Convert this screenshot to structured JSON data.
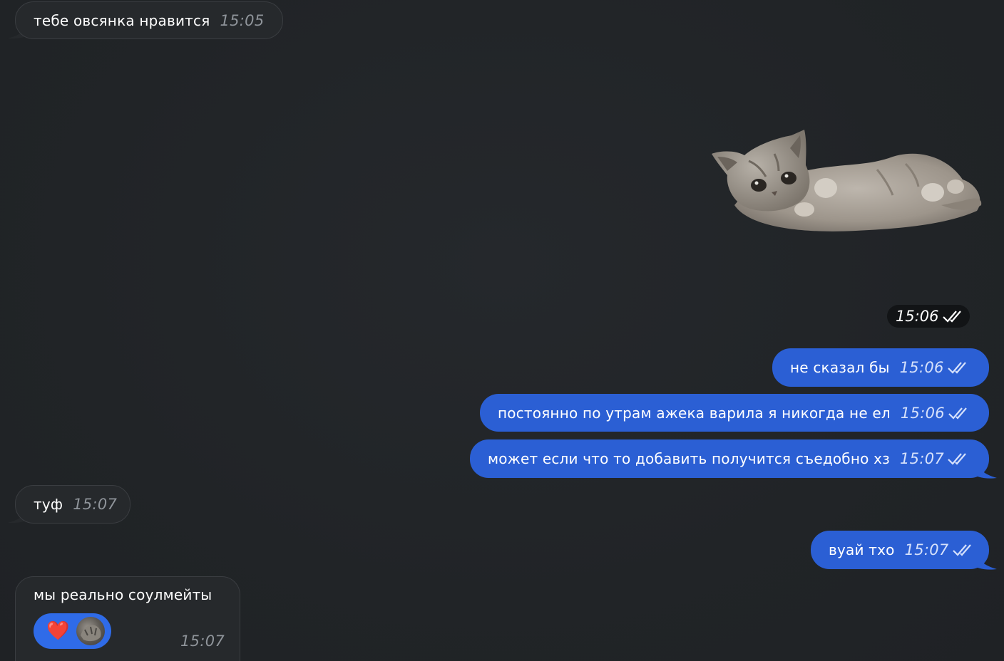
{
  "messages": [
    {
      "text": "тебе овсянка нравится",
      "time": "15:05",
      "direction": "in"
    },
    {
      "type": "sticker",
      "sticker": "kitten-lying-sticker",
      "time": "15:06",
      "direction": "out",
      "read": true
    },
    {
      "text": "не сказал бы",
      "time": "15:06",
      "direction": "out",
      "read": true
    },
    {
      "text": "постоянно по утрам ажека варила я никогда не ел",
      "time": "15:06",
      "direction": "out",
      "read": true
    },
    {
      "text": "может если что то добавить получится съедобно хз",
      "time": "15:07",
      "direction": "out",
      "read": true
    },
    {
      "text": "туф",
      "time": "15:07",
      "direction": "in"
    },
    {
      "text": "вуай тхо",
      "time": "15:07",
      "direction": "out",
      "read": true
    },
    {
      "text": "мы реально соулмейты",
      "time": "15:07",
      "direction": "in",
      "reaction": {
        "emoji": "❤️",
        "icon": "reactor-avatar"
      }
    }
  ],
  "colors": {
    "background": "#212427",
    "incoming_bubble": "#26292c",
    "outgoing_bubble": "#2b5fd4",
    "reaction_pill": "#2f6be8"
  }
}
